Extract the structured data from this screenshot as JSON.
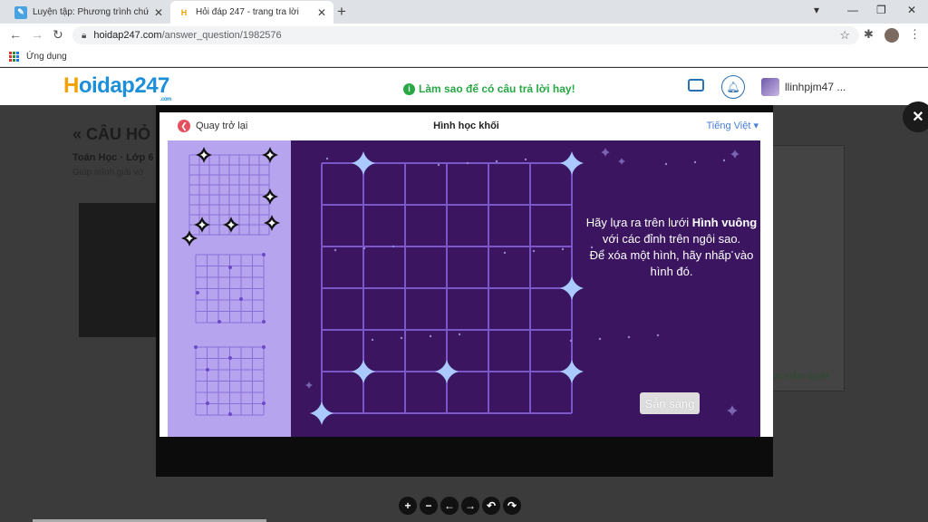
{
  "browser": {
    "tabs": [
      {
        "title": "Luyện tập: Phương trình chứa dấ",
        "active": false
      },
      {
        "title": "Hỏi đáp 247 - trang tra lời",
        "active": true
      }
    ],
    "url_host": "hoidap247.com",
    "url_path": "/answer_question/1982576",
    "bookmarks_apps_label": "Ứng dụng"
  },
  "site": {
    "logo_h": "H",
    "logo_rest": "oidap247",
    "logo_com": ".com",
    "howto_text": "Làm sao để có câu trả lời hay!",
    "username": "llinhpjm47 ...",
    "colors": {
      "brand_blue": "#1d8fd8",
      "brand_orange": "#f2a100",
      "howto_green": "#27a844"
    }
  },
  "background_page": {
    "title": "« CÂU HỎ",
    "subject": "Toán Học · Lớp 6",
    "help": "Giúp mình giải vớ",
    "review_text": "ợc kiểm duyệt"
  },
  "activity": {
    "back_label": "Quay trở lại",
    "title": "Hình học khối",
    "language": "Tiếng Việt",
    "instruction_line1": "Hãy lựa ra trên lưới ",
    "instruction_bold": "Hình vuông",
    "instruction_line2": " với các đỉnh trên ngôi sao.",
    "instruction_line3": "Để xóa một hình, hãy nhấp vào hình đó.",
    "ready_label": "Sẵn sàng",
    "colors": {
      "board": "#3b1560",
      "sidebar": "#b7a4ef",
      "grid_line": "#7b56c8",
      "star": "#a9c9ff"
    }
  },
  "toolbar": {
    "buttons": [
      "+",
      "−",
      "←",
      "→",
      "↶",
      "↷"
    ]
  }
}
